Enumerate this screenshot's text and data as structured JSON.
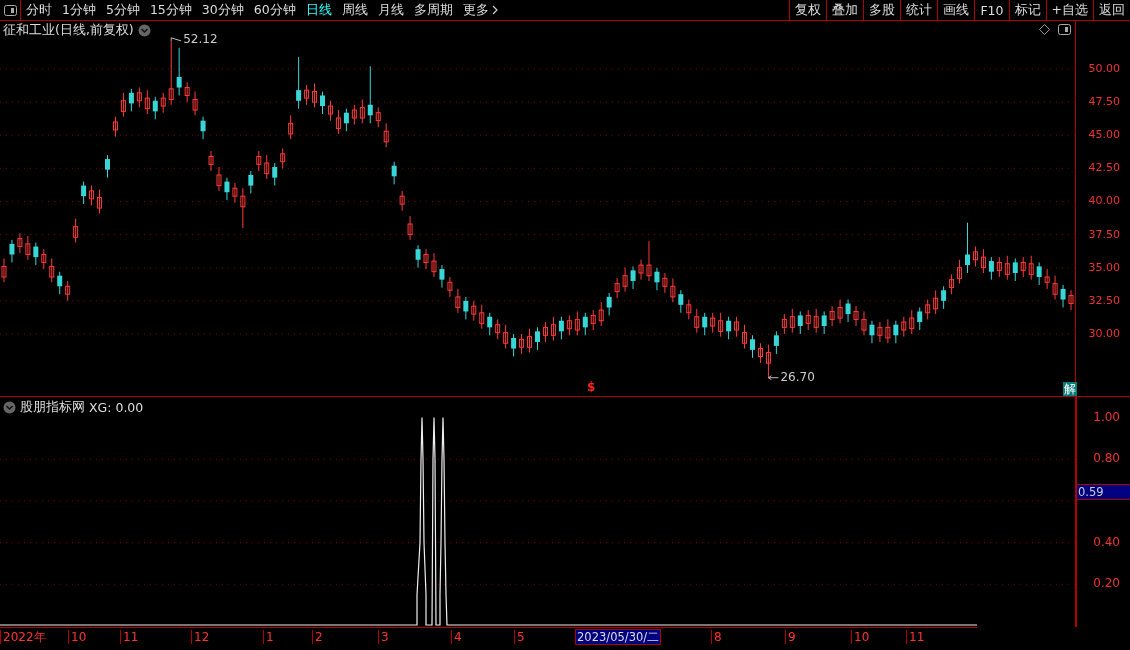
{
  "toolbar": {
    "periods": [
      {
        "label": "分时",
        "selected": false
      },
      {
        "label": "1分钟",
        "selected": false
      },
      {
        "label": "5分钟",
        "selected": false
      },
      {
        "label": "15分钟",
        "selected": false
      },
      {
        "label": "30分钟",
        "selected": false
      },
      {
        "label": "60分钟",
        "selected": false
      },
      {
        "label": "日线",
        "selected": true
      },
      {
        "label": "周线",
        "selected": false
      },
      {
        "label": "月线",
        "selected": false
      },
      {
        "label": "多周期",
        "selected": false
      },
      {
        "label": "更多",
        "selected": false
      }
    ],
    "buttons": [
      "复权",
      "叠加",
      "多股",
      "统计",
      "画线",
      "F10",
      "标记",
      "+自选",
      "返回"
    ]
  },
  "main_chart": {
    "title": "征和工业(日线,前复权)",
    "high_label": "52.12",
    "low_label": "26.70",
    "signal_mark": "$",
    "badge": "解",
    "chart_data": {
      "type": "candlestick",
      "grid": true,
      "ylim": [
        25.32,
        53.62
      ],
      "yticks": [
        {
          "value": 50,
          "label": "50.00"
        },
        {
          "value": 47.5,
          "label": "47.50"
        },
        {
          "value": 45,
          "label": "45.00"
        },
        {
          "value": 42.5,
          "label": "42.50"
        },
        {
          "value": 40,
          "label": "40.00"
        },
        {
          "value": 37.5,
          "label": "37.50"
        },
        {
          "value": 35,
          "label": "35.00"
        },
        {
          "value": 32.5,
          "label": "32.50"
        },
        {
          "value": 30,
          "label": "30.00"
        }
      ],
      "ohlc": [
        [
          34.3,
          35.7,
          33.9,
          35.1
        ],
        [
          36.8,
          37.1,
          35.4,
          36.0
        ],
        [
          36.6,
          37.6,
          36.1,
          37.2
        ],
        [
          36.0,
          37.4,
          35.6,
          36.8
        ],
        [
          36.6,
          36.9,
          35.2,
          35.8
        ],
        [
          35.4,
          36.4,
          34.9,
          36.0
        ],
        [
          34.3,
          35.7,
          33.9,
          35.1
        ],
        [
          34.4,
          34.7,
          33.0,
          33.6
        ],
        [
          33.0,
          34.0,
          32.5,
          33.6
        ],
        [
          37.3,
          38.7,
          36.9,
          38.1
        ],
        [
          41.2,
          41.5,
          39.8,
          40.4
        ],
        [
          40.2,
          41.2,
          39.7,
          40.8
        ],
        [
          39.5,
          40.9,
          39.1,
          40.3
        ],
        [
          43.2,
          43.5,
          41.8,
          42.4
        ],
        [
          45.4,
          46.4,
          44.9,
          46.0
        ],
        [
          46.8,
          48.2,
          46.4,
          47.6
        ],
        [
          48.2,
          48.5,
          46.8,
          47.4
        ],
        [
          47.6,
          48.6,
          47.1,
          48.2
        ],
        [
          47.0,
          48.4,
          46.6,
          47.8
        ],
        [
          47.6,
          47.9,
          46.2,
          46.8
        ],
        [
          47.2,
          48.2,
          46.7,
          47.8
        ],
        [
          47.7,
          52.12,
          47.3,
          48.5
        ],
        [
          49.4,
          51.6,
          48.0,
          48.6
        ],
        [
          48.0,
          49.0,
          47.5,
          48.6
        ],
        [
          46.9,
          48.3,
          46.5,
          47.7
        ],
        [
          46.1,
          46.4,
          44.7,
          45.3
        ],
        [
          42.8,
          43.8,
          42.3,
          43.4
        ],
        [
          41.2,
          42.6,
          40.8,
          42.0
        ],
        [
          41.5,
          41.8,
          40.1,
          40.7
        ],
        [
          40.4,
          41.4,
          39.9,
          41.0
        ],
        [
          39.6,
          41.0,
          38.0,
          40.4
        ],
        [
          42.0,
          42.3,
          40.6,
          41.2
        ],
        [
          42.8,
          43.8,
          42.3,
          43.4
        ],
        [
          42.1,
          43.5,
          41.7,
          42.9
        ],
        [
          42.6,
          42.9,
          41.2,
          41.8
        ],
        [
          43.0,
          44.0,
          42.5,
          43.6
        ],
        [
          45.1,
          46.5,
          44.7,
          45.9
        ],
        [
          48.4,
          50.9,
          47.0,
          47.6
        ],
        [
          47.8,
          48.8,
          47.3,
          48.4
        ],
        [
          47.5,
          48.9,
          47.1,
          48.3
        ],
        [
          48.0,
          48.3,
          46.6,
          47.2
        ],
        [
          46.6,
          47.6,
          46.1,
          47.2
        ],
        [
          45.5,
          46.9,
          45.1,
          46.3
        ],
        [
          46.7,
          47.0,
          45.3,
          45.9
        ],
        [
          46.3,
          47.3,
          45.8,
          46.9
        ],
        [
          46.3,
          47.7,
          45.9,
          47.1
        ],
        [
          47.3,
          50.2,
          45.9,
          46.5
        ],
        [
          46.1,
          47.1,
          45.6,
          46.7
        ],
        [
          44.5,
          45.9,
          44.1,
          45.3
        ],
        [
          42.7,
          43.0,
          41.3,
          41.9
        ],
        [
          39.8,
          40.8,
          39.3,
          40.4
        ],
        [
          37.5,
          38.9,
          37.1,
          38.3
        ],
        [
          36.4,
          36.7,
          35.0,
          35.6
        ],
        [
          35.4,
          36.4,
          34.9,
          36.0
        ],
        [
          34.7,
          36.1,
          34.3,
          35.5
        ],
        [
          34.9,
          35.2,
          33.5,
          34.1
        ],
        [
          33.3,
          34.3,
          32.8,
          33.9
        ],
        [
          32.0,
          33.4,
          31.6,
          32.8
        ],
        [
          32.5,
          32.8,
          31.1,
          31.7
        ],
        [
          31.5,
          32.5,
          31.0,
          32.1
        ],
        [
          30.8,
          32.2,
          30.4,
          31.6
        ],
        [
          31.3,
          31.6,
          29.9,
          30.5
        ],
        [
          30.1,
          31.1,
          29.6,
          30.7
        ],
        [
          29.3,
          30.7,
          28.9,
          30.1
        ],
        [
          29.7,
          30.0,
          28.3,
          28.9
        ],
        [
          29.0,
          30.0,
          28.5,
          29.6
        ],
        [
          29.0,
          30.4,
          28.6,
          29.8
        ],
        [
          30.2,
          30.5,
          28.8,
          29.4
        ],
        [
          29.9,
          30.9,
          29.4,
          30.5
        ],
        [
          29.9,
          31.3,
          29.5,
          30.7
        ],
        [
          31.0,
          31.3,
          29.6,
          30.2
        ],
        [
          30.4,
          31.4,
          29.9,
          31.0
        ],
        [
          30.3,
          31.7,
          29.9,
          31.1
        ],
        [
          31.3,
          31.6,
          29.9,
          30.5
        ],
        [
          30.8,
          31.8,
          30.3,
          31.4
        ],
        [
          31.0,
          32.4,
          30.6,
          31.8
        ],
        [
          32.8,
          33.1,
          31.4,
          32.0
        ],
        [
          33.2,
          34.2,
          32.7,
          33.8
        ],
        [
          33.6,
          35.0,
          33.2,
          34.4
        ],
        [
          34.8,
          35.1,
          33.4,
          34.0
        ],
        [
          34.6,
          35.6,
          34.1,
          35.2
        ],
        [
          34.4,
          37.0,
          34.0,
          35.2
        ],
        [
          34.7,
          35.0,
          33.3,
          33.9
        ],
        [
          33.6,
          34.6,
          33.1,
          34.2
        ],
        [
          32.8,
          34.2,
          32.4,
          33.6
        ],
        [
          33.0,
          33.3,
          31.6,
          32.2
        ],
        [
          31.6,
          32.6,
          31.1,
          32.2
        ],
        [
          30.5,
          31.9,
          30.1,
          31.3
        ],
        [
          31.3,
          31.6,
          29.9,
          30.5
        ],
        [
          30.6,
          31.6,
          30.1,
          31.2
        ],
        [
          30.2,
          31.6,
          29.8,
          31.0
        ],
        [
          31.0,
          31.3,
          29.6,
          30.2
        ],
        [
          30.3,
          31.3,
          29.8,
          30.9
        ],
        [
          29.3,
          30.7,
          28.9,
          30.1
        ],
        [
          29.6,
          29.9,
          28.2,
          28.8
        ],
        [
          28.3,
          29.3,
          27.8,
          28.9
        ],
        [
          27.8,
          29.2,
          26.7,
          28.6
        ],
        [
          29.9,
          30.2,
          28.5,
          29.1
        ],
        [
          30.5,
          31.5,
          30.0,
          31.1
        ],
        [
          30.5,
          31.9,
          30.1,
          31.3
        ],
        [
          31.4,
          31.7,
          30.0,
          30.6
        ],
        [
          30.8,
          31.8,
          30.3,
          31.4
        ],
        [
          30.5,
          31.9,
          30.1,
          31.3
        ],
        [
          31.4,
          31.7,
          30.0,
          30.6
        ],
        [
          31.1,
          32.1,
          30.6,
          31.7
        ],
        [
          31.2,
          32.6,
          30.8,
          32.0
        ],
        [
          32.3,
          32.6,
          30.9,
          31.5
        ],
        [
          31.1,
          32.1,
          30.6,
          31.7
        ],
        [
          30.3,
          31.7,
          29.9,
          31.1
        ],
        [
          30.7,
          31.0,
          29.3,
          29.9
        ],
        [
          29.9,
          30.9,
          29.4,
          30.5
        ],
        [
          29.7,
          31.1,
          29.3,
          30.5
        ],
        [
          30.7,
          31.0,
          29.3,
          29.9
        ],
        [
          30.3,
          31.3,
          29.8,
          30.9
        ],
        [
          30.4,
          31.8,
          30.0,
          31.2
        ],
        [
          31.7,
          32.0,
          30.3,
          30.9
        ],
        [
          31.6,
          32.6,
          31.1,
          32.2
        ],
        [
          31.9,
          33.3,
          31.5,
          32.7
        ],
        [
          33.3,
          33.6,
          31.9,
          32.5
        ],
        [
          33.5,
          34.5,
          33.0,
          34.1
        ],
        [
          34.2,
          35.6,
          33.8,
          35.0
        ],
        [
          36.0,
          38.4,
          34.6,
          35.2
        ],
        [
          35.6,
          36.6,
          35.1,
          36.2
        ],
        [
          35.0,
          36.4,
          34.6,
          35.8
        ],
        [
          35.5,
          35.8,
          34.1,
          34.7
        ],
        [
          34.8,
          35.8,
          34.3,
          35.4
        ],
        [
          34.5,
          35.9,
          34.1,
          35.3
        ],
        [
          35.4,
          35.7,
          34.0,
          34.6
        ],
        [
          34.8,
          35.8,
          34.3,
          35.4
        ],
        [
          34.5,
          35.9,
          34.1,
          35.3
        ],
        [
          35.1,
          35.4,
          33.7,
          34.3
        ],
        [
          33.9,
          34.9,
          33.4,
          34.3
        ],
        [
          33.0,
          34.4,
          32.6,
          33.8
        ],
        [
          33.4,
          33.7,
          32.0,
          32.6
        ],
        [
          32.3,
          33.3,
          31.8,
          32.9
        ]
      ]
    }
  },
  "indicator": {
    "title": "股朋指标网",
    "reading": "XG: 0.00",
    "axis": [
      "1.00",
      "0.80",
      "0.40",
      "0.20"
    ],
    "current_value": "0.59"
  },
  "date_axis": {
    "labels": [
      "2022年",
      "10",
      "11",
      "12",
      "1",
      "2",
      "3",
      "4",
      "5",
      "8",
      "9",
      "10",
      "11"
    ],
    "cursor_date": "2023/05/30/二"
  }
}
